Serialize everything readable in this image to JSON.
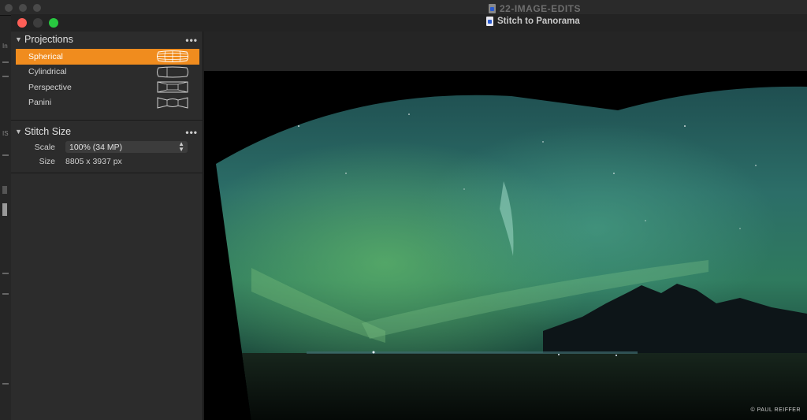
{
  "background_app": {
    "title": "22-IMAGE-EDITS",
    "left_strip_labels": [
      "In",
      "IS"
    ]
  },
  "window": {
    "title": "Stitch to Panorama"
  },
  "panel": {
    "projections": {
      "header": "Projections",
      "menu_icon": "ellipsis-icon",
      "items": [
        {
          "label": "Spherical",
          "icon": "spherical-projection-icon",
          "selected": true
        },
        {
          "label": "Cylindrical",
          "icon": "cylindrical-projection-icon",
          "selected": false
        },
        {
          "label": "Perspective",
          "icon": "perspective-projection-icon",
          "selected": false
        },
        {
          "label": "Panini",
          "icon": "panini-projection-icon",
          "selected": false
        }
      ]
    },
    "stitch_size": {
      "header": "Stitch Size",
      "menu_icon": "ellipsis-icon",
      "scale_label": "Scale",
      "scale_value": "100% (34 MP)",
      "size_label": "Size",
      "size_value": "8805 x 3937 px"
    }
  },
  "preview": {
    "credit": "© PAUL REIFFER"
  },
  "colors": {
    "accent": "#f08c1e",
    "close": "#fe5f57",
    "zoom": "#28c840",
    "panel_bg": "#2c2c2c"
  }
}
